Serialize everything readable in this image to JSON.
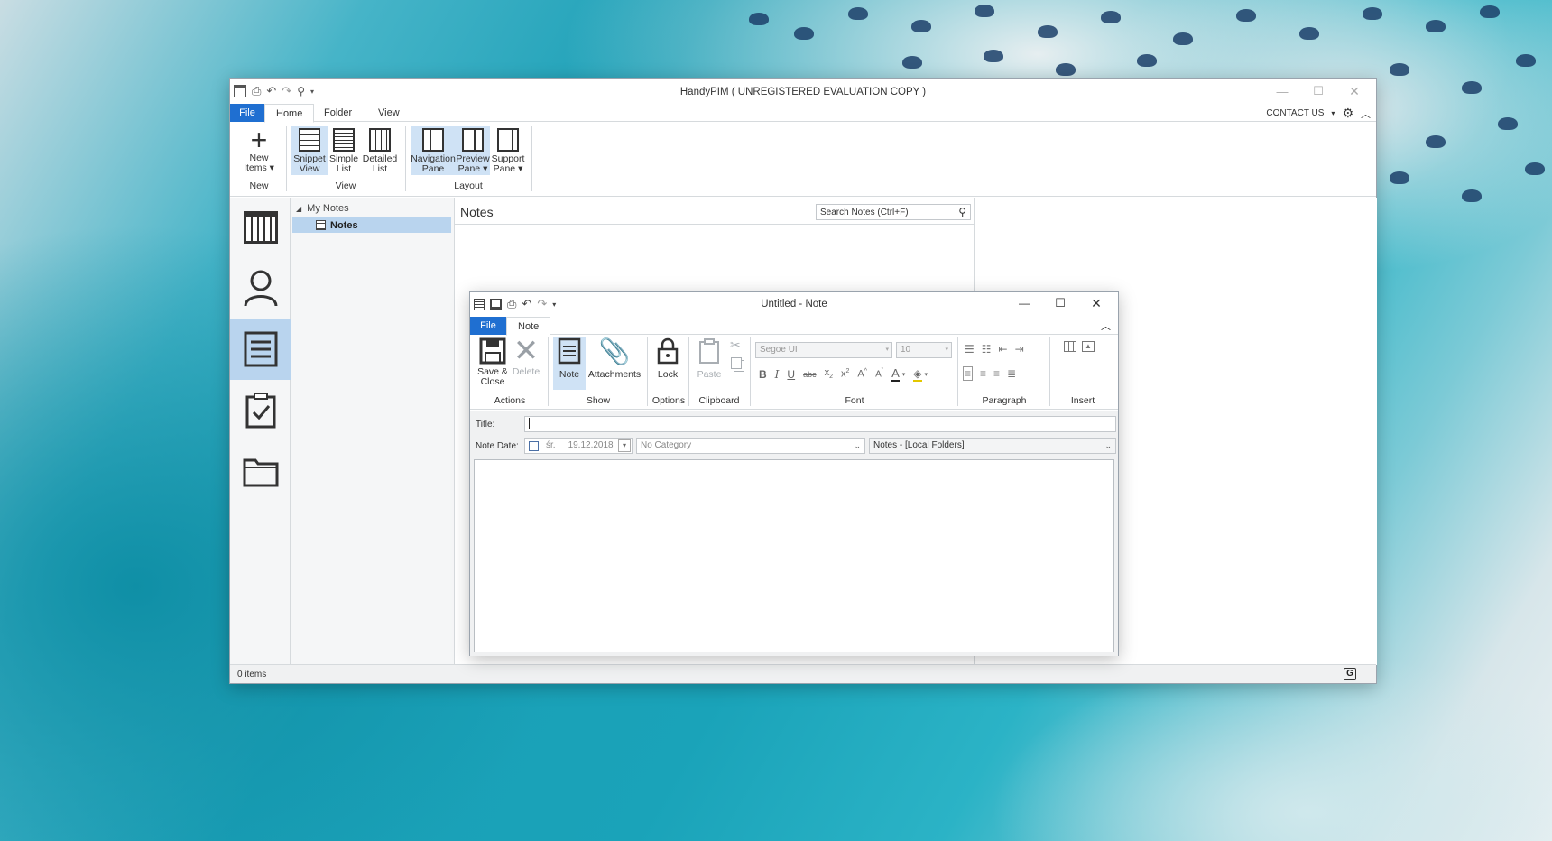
{
  "main_window": {
    "title": "HandyPIM ( UNREGISTERED EVALUATION COPY )",
    "tabs": [
      {
        "label": "File"
      },
      {
        "label": "Home"
      },
      {
        "label": "Folder"
      },
      {
        "label": "View"
      }
    ],
    "contact_us": "CONTACT US",
    "ribbon": {
      "new_items_label_1": "New",
      "new_items_label_2": "Items",
      "group_new": "New",
      "snippet_view_1": "Snippet",
      "snippet_view_2": "View",
      "simple_list_1": "Simple",
      "simple_list_2": "List",
      "detailed_list_1": "Detailed",
      "detailed_list_2": "List",
      "group_view": "View",
      "navigation_pane_1": "Navigation",
      "navigation_pane_2": "Pane",
      "preview_pane_1": "Preview",
      "preview_pane_2": "Pane",
      "support_pane_1": "Support",
      "support_pane_2": "Pane",
      "group_layout": "Layout"
    },
    "folder_tree": {
      "root": "My Notes",
      "child": "Notes"
    },
    "list": {
      "header": "Notes",
      "search_placeholder": "Search Notes (Ctrl+F)"
    },
    "status": "0 items"
  },
  "note_window": {
    "title": "Untitled - Note",
    "tabs": [
      {
        "label": "File"
      },
      {
        "label": "Note"
      }
    ],
    "ribbon": {
      "save_close_1": "Save &",
      "save_close_2": "Close",
      "delete": "Delete",
      "group_actions": "Actions",
      "note": "Note",
      "attachments": "Attachments",
      "group_show": "Show",
      "lock": "Lock",
      "group_options": "Options",
      "paste": "Paste",
      "group_clipboard": "Clipboard",
      "font_name": "Segoe UI",
      "font_size": "10",
      "group_font": "Font",
      "group_paragraph": "Paragraph",
      "group_insert": "Insert"
    },
    "form": {
      "title_label": "Title:",
      "title_value": "",
      "date_label": "Note Date:",
      "date_day": "śr.",
      "date_value": "19.12.2018",
      "category": "No Category",
      "folder": "Notes - [Local Folders]"
    }
  },
  "colors": {
    "accent": "#1f6fd1",
    "selection": "#cfe2f5",
    "nav_selected": "#b9d4ee"
  }
}
